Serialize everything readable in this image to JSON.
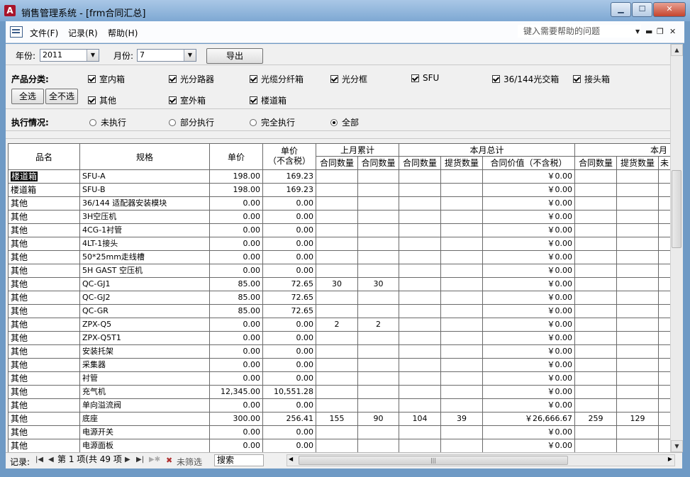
{
  "window": {
    "title": "销售管理系统 - [frm合同汇总]",
    "app_icon": "A"
  },
  "menubar": {
    "items": [
      "文件(F)",
      "记录(R)",
      "帮助(H)"
    ],
    "help_placeholder": "键入需要帮助的问题"
  },
  "filters": {
    "year_label": "年份:",
    "year_value": "2011",
    "month_label": "月份:",
    "month_value": "7",
    "export_label": "导出",
    "category_label": "产品分类:",
    "select_all_label": "全选",
    "deselect_all_label": "全不选",
    "categories": [
      {
        "label": "室内箱",
        "checked": true
      },
      {
        "label": "光分路器",
        "checked": true
      },
      {
        "label": "光缆分纤箱",
        "checked": true
      },
      {
        "label": "光分框",
        "checked": true
      },
      {
        "label": "SFU",
        "checked": true
      },
      {
        "label": "36/144光交箱",
        "checked": true
      },
      {
        "label": "接头箱",
        "checked": true
      },
      {
        "label": "其他",
        "checked": true
      },
      {
        "label": "室外箱",
        "checked": true
      },
      {
        "label": "楼道箱",
        "checked": true
      }
    ],
    "execution_label": "执行情况:",
    "execution_options": [
      {
        "label": "未执行",
        "selected": false
      },
      {
        "label": "部分执行",
        "selected": false
      },
      {
        "label": "完全执行",
        "selected": false
      },
      {
        "label": "全部",
        "selected": true
      }
    ]
  },
  "table": {
    "headers": {
      "name": "品名",
      "spec": "规格",
      "price": "单价",
      "price_ex_tax": "单价\n（不含税）",
      "last_month_group": "上月累计",
      "this_month_group": "本月总计",
      "next_group": "本月",
      "contract_qty": "合同数量",
      "delivery_qty": "提货数量",
      "contract_value_ex_tax": "合同价值（不含税）",
      "truncated": "未"
    },
    "rows": [
      {
        "name": "楼道箱",
        "spec": "SFU-A",
        "price": "198.00",
        "price_ex": "169.23",
        "lm1": "",
        "lm2": "",
        "tm1": "",
        "tm2": "",
        "value": "￥0.00",
        "n1": "",
        "n2": ""
      },
      {
        "name": "楼道箱",
        "spec": "SFU-B",
        "price": "198.00",
        "price_ex": "169.23",
        "lm1": "",
        "lm2": "",
        "tm1": "",
        "tm2": "",
        "value": "￥0.00",
        "n1": "",
        "n2": ""
      },
      {
        "name": "其他",
        "spec": "36/144 适配器安装模块",
        "price": "0.00",
        "price_ex": "0.00",
        "lm1": "",
        "lm2": "",
        "tm1": "",
        "tm2": "",
        "value": "￥0.00",
        "n1": "",
        "n2": ""
      },
      {
        "name": "其他",
        "spec": "3H空压机",
        "price": "0.00",
        "price_ex": "0.00",
        "lm1": "",
        "lm2": "",
        "tm1": "",
        "tm2": "",
        "value": "￥0.00",
        "n1": "",
        "n2": ""
      },
      {
        "name": "其他",
        "spec": "4CG-1衬管",
        "price": "0.00",
        "price_ex": "0.00",
        "lm1": "",
        "lm2": "",
        "tm1": "",
        "tm2": "",
        "value": "￥0.00",
        "n1": "",
        "n2": ""
      },
      {
        "name": "其他",
        "spec": "4LT-1接头",
        "price": "0.00",
        "price_ex": "0.00",
        "lm1": "",
        "lm2": "",
        "tm1": "",
        "tm2": "",
        "value": "￥0.00",
        "n1": "",
        "n2": ""
      },
      {
        "name": "其他",
        "spec": "50*25mm走线槽",
        "price": "0.00",
        "price_ex": "0.00",
        "lm1": "",
        "lm2": "",
        "tm1": "",
        "tm2": "",
        "value": "￥0.00",
        "n1": "",
        "n2": ""
      },
      {
        "name": "其他",
        "spec": "5H GAST 空压机",
        "price": "0.00",
        "price_ex": "0.00",
        "lm1": "",
        "lm2": "",
        "tm1": "",
        "tm2": "",
        "value": "￥0.00",
        "n1": "",
        "n2": ""
      },
      {
        "name": "其他",
        "spec": "QC-GJ1",
        "price": "85.00",
        "price_ex": "72.65",
        "lm1": "30",
        "lm2": "30",
        "tm1": "",
        "tm2": "",
        "value": "￥0.00",
        "n1": "",
        "n2": ""
      },
      {
        "name": "其他",
        "spec": "QC-GJ2",
        "price": "85.00",
        "price_ex": "72.65",
        "lm1": "",
        "lm2": "",
        "tm1": "",
        "tm2": "",
        "value": "￥0.00",
        "n1": "",
        "n2": ""
      },
      {
        "name": "其他",
        "spec": "QC-GR",
        "price": "85.00",
        "price_ex": "72.65",
        "lm1": "",
        "lm2": "",
        "tm1": "",
        "tm2": "",
        "value": "￥0.00",
        "n1": "",
        "n2": ""
      },
      {
        "name": "其他",
        "spec": "ZPX-Q5",
        "price": "0.00",
        "price_ex": "0.00",
        "lm1": "2",
        "lm2": "2",
        "tm1": "",
        "tm2": "",
        "value": "￥0.00",
        "n1": "",
        "n2": ""
      },
      {
        "name": "其他",
        "spec": "ZPX-Q5T1",
        "price": "0.00",
        "price_ex": "0.00",
        "lm1": "",
        "lm2": "",
        "tm1": "",
        "tm2": "",
        "value": "￥0.00",
        "n1": "",
        "n2": ""
      },
      {
        "name": "其他",
        "spec": "安装托架",
        "price": "0.00",
        "price_ex": "0.00",
        "lm1": "",
        "lm2": "",
        "tm1": "",
        "tm2": "",
        "value": "￥0.00",
        "n1": "",
        "n2": ""
      },
      {
        "name": "其他",
        "spec": "采集器",
        "price": "0.00",
        "price_ex": "0.00",
        "lm1": "",
        "lm2": "",
        "tm1": "",
        "tm2": "",
        "value": "￥0.00",
        "n1": "",
        "n2": ""
      },
      {
        "name": "其他",
        "spec": "衬管",
        "price": "0.00",
        "price_ex": "0.00",
        "lm1": "",
        "lm2": "",
        "tm1": "",
        "tm2": "",
        "value": "￥0.00",
        "n1": "",
        "n2": ""
      },
      {
        "name": "其他",
        "spec": "充气机",
        "price": "12,345.00",
        "price_ex": "10,551.28",
        "lm1": "",
        "lm2": "",
        "tm1": "",
        "tm2": "",
        "value": "￥0.00",
        "n1": "",
        "n2": ""
      },
      {
        "name": "其他",
        "spec": "单向溢流阀",
        "price": "0.00",
        "price_ex": "0.00",
        "lm1": "",
        "lm2": "",
        "tm1": "",
        "tm2": "",
        "value": "￥0.00",
        "n1": "",
        "n2": ""
      },
      {
        "name": "其他",
        "spec": "底座",
        "price": "300.00",
        "price_ex": "256.41",
        "lm1": "155",
        "lm2": "90",
        "tm1": "104",
        "tm2": "39",
        "value": "￥26,666.67",
        "n1": "259",
        "n2": "129"
      },
      {
        "name": "其他",
        "spec": "电源开关",
        "price": "0.00",
        "price_ex": "0.00",
        "lm1": "",
        "lm2": "",
        "tm1": "",
        "tm2": "",
        "value": "￥0.00",
        "n1": "",
        "n2": ""
      },
      {
        "name": "其他",
        "spec": "电源面板",
        "price": "0.00",
        "price_ex": "0.00",
        "lm1": "",
        "lm2": "",
        "tm1": "",
        "tm2": "",
        "value": "￥0.00",
        "n1": "",
        "n2": ""
      }
    ]
  },
  "navbar": {
    "record_label": "记录:",
    "record_position": "第 1 项(共 49 项",
    "filter_label": "未筛选",
    "search_label": "搜索"
  }
}
